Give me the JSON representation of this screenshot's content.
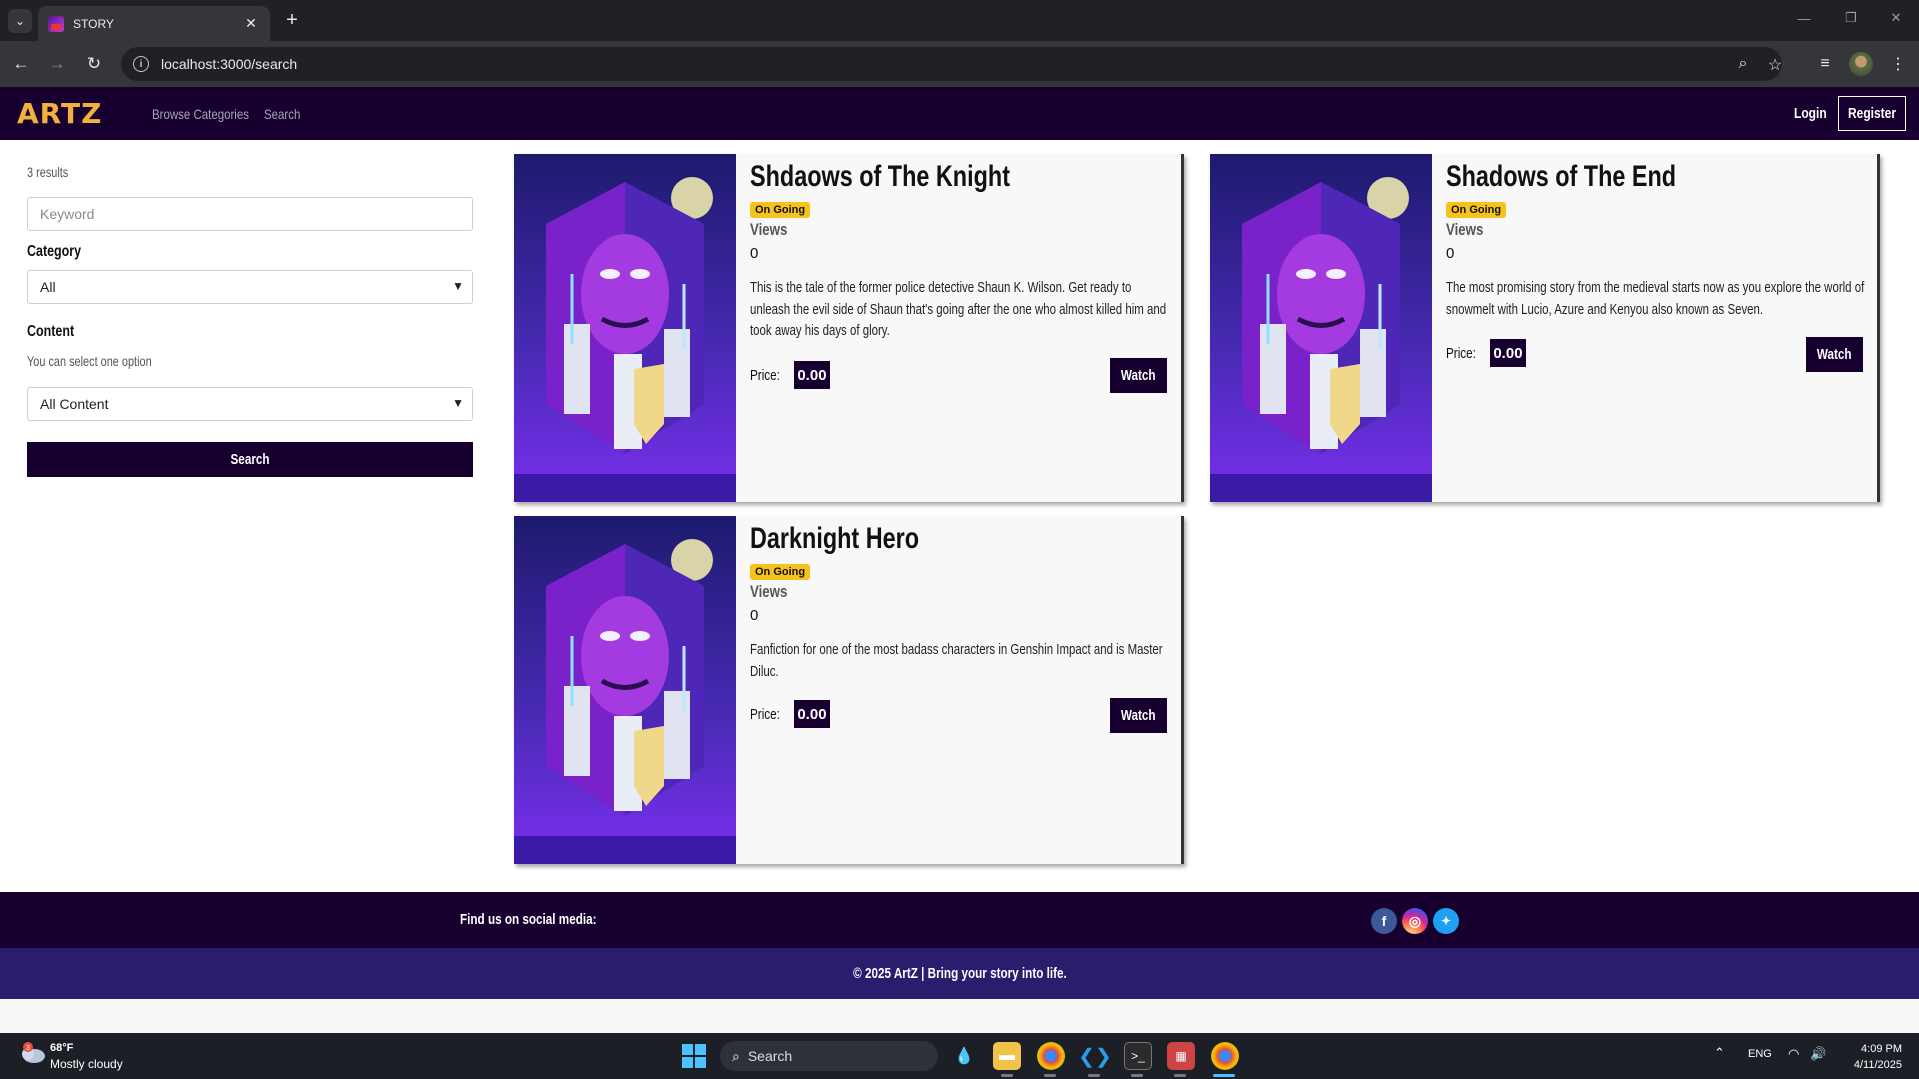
{
  "browser": {
    "tab_title": "STORY",
    "url": "localhost:3000/search"
  },
  "site": {
    "logo": "ARTZ",
    "nav": {
      "browse_categories": "Browse Categories",
      "search": "Search",
      "login": "Login",
      "register": "Register"
    }
  },
  "filters": {
    "results_count": "3 results",
    "keyword_placeholder": "Keyword",
    "category_label": "Category",
    "category_value": "All",
    "content_label": "Content",
    "content_hint": "You can select one option",
    "content_value": "All Content",
    "search_button": "Search"
  },
  "stories": [
    {
      "title": "Shdaows of The Knight",
      "status": "On Going",
      "views_label": "Views",
      "views": "0",
      "description": "This is the tale of the former police detective Shaun K. Wilson. Get ready to unleash the evil side of Shaun that's going after the one who almost killed him and took away his days of glory.",
      "price_label": "Price:",
      "price": "0.00",
      "watch_label": "Watch"
    },
    {
      "title": "Shadows of The End",
      "status": "On Going",
      "views_label": "Views",
      "views": "0",
      "description": "The most promising story from the medieval starts now as you explore the world of snowmelt with Lucio, Azure and Kenyou also known as Seven.",
      "price_label": "Price:",
      "price": "0.00",
      "watch_label": "Watch"
    },
    {
      "title": "Darknight Hero",
      "status": "On Going",
      "views_label": "Views",
      "views": "0",
      "description": "Fanfiction for one of the most badass characters in Genshin Impact and is Master Diluc.",
      "price_label": "Price:",
      "price": "0.00",
      "watch_label": "Watch"
    }
  ],
  "footer": {
    "social_text": "Find us on social media:",
    "copyright": "© 2025 ArtZ | Bring your story into life."
  },
  "taskbar": {
    "weather_badge": "3",
    "temperature": "68°F",
    "weather": "Mostly cloudy",
    "search_placeholder": "Search",
    "language": "ENG",
    "time": "4:09 PM",
    "date": "4/11/2025"
  },
  "colors": {
    "navbar": "#17002f",
    "logo": "#f1b13f",
    "badge": "#f7c21b",
    "footer_copy": "#2c1c6e"
  }
}
